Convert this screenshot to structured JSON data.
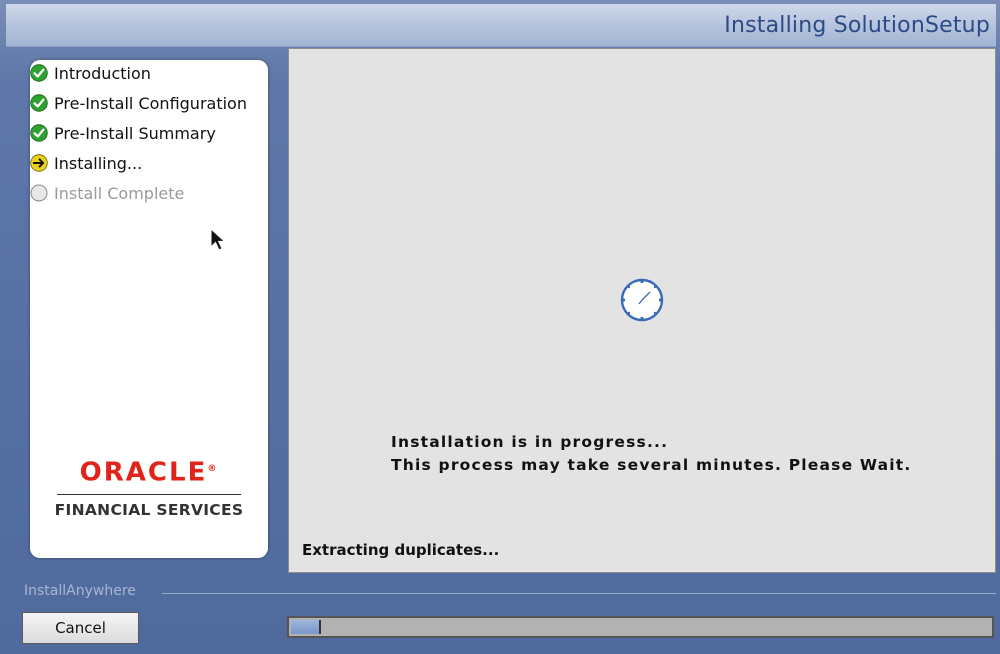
{
  "window": {
    "title": "Installing SolutionSetup"
  },
  "steps": [
    {
      "label": "Introduction",
      "state": "complete",
      "icon": "check-circle-icon"
    },
    {
      "label": "Pre-Install Configuration",
      "state": "complete",
      "icon": "check-circle-icon"
    },
    {
      "label": "Pre-Install Summary",
      "state": "complete",
      "icon": "check-circle-icon"
    },
    {
      "label": "Installing...",
      "state": "current",
      "icon": "arrow-circle-icon"
    },
    {
      "label": "Install Complete",
      "state": "pending",
      "icon": "empty-circle-icon"
    }
  ],
  "logo": {
    "brand": "ORACLE",
    "registered_mark": "®",
    "division": "FINANCIAL SERVICES"
  },
  "main": {
    "message_line1": "Installation is in progress...",
    "message_line2": "This process may take several minutes. Please Wait.",
    "status": "Extracting duplicates..."
  },
  "footer": {
    "vendor": "InstallAnywhere",
    "cancel_label": "Cancel",
    "progress_fraction": 0.04
  },
  "colors": {
    "title_text": "#2c4a86",
    "complete_icon": "#2ea22e",
    "current_icon": "#e8d21a",
    "oracle_red": "#e2231a",
    "clock_blue": "#3b6bb8"
  }
}
